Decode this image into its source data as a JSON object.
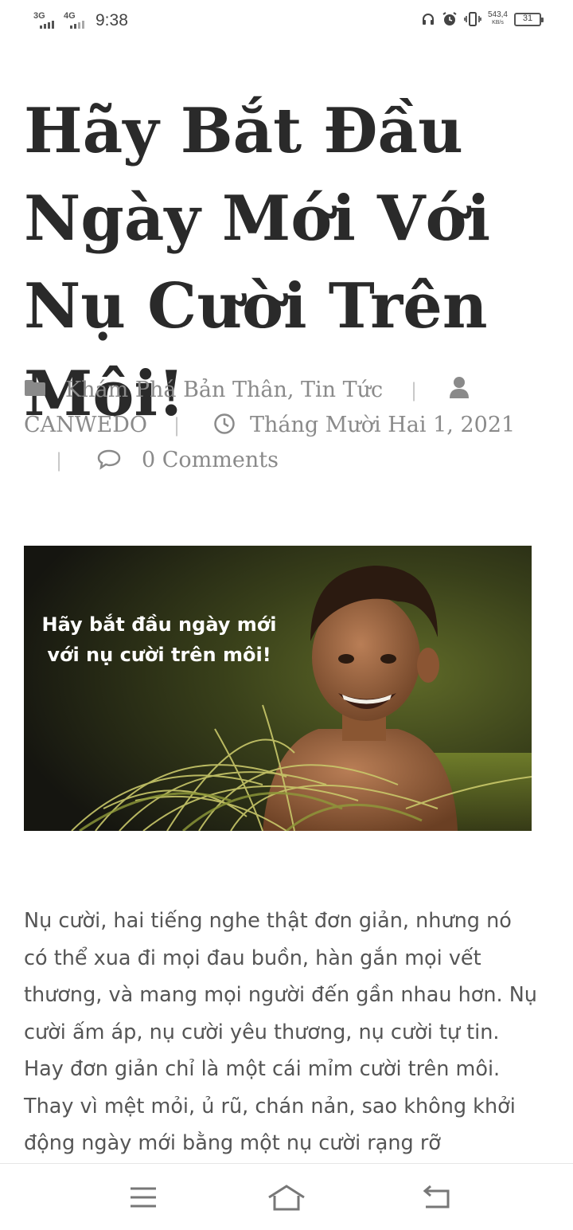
{
  "status_bar": {
    "network_1": "3G",
    "network_2": "4G",
    "time": "9:38",
    "speed_value": "543,4",
    "speed_unit": "KB/s",
    "battery_level": "31"
  },
  "article": {
    "title": "Hãy Bắt Đầu Ngày Mới Với Nụ Cười Trên Môi!",
    "categories": "Khám Phá Bản Thân, Tin Tức",
    "author": "CANWEDO",
    "date": "Tháng Mười Hai 1, 2021",
    "comments": "0 Comments",
    "separator": "|",
    "image_caption_line1": "Hãy bắt đầu ngày mới",
    "image_caption_line2": "với nụ cười trên môi!",
    "body": "Nụ cười, hai tiếng nghe thật đơn giản, nhưng nó có thể xua đi mọi đau buồn, hàn gắn mọi vết thương, và mang mọi người đến gần nhau hơn. Nụ cười ấm áp, nụ cười yêu thương, nụ cười tự tin. Hay đơn giản chỉ là một cái mỉm cười trên môi. Thay vì mệt mỏi, ủ rũ, chán nản, sao không khởi động ngày mới bằng một nụ cười rạng rỡ"
  },
  "nav": {
    "menu_icon": "menu-icon",
    "home_icon": "home-icon",
    "back_icon": "back-icon"
  },
  "colors": {
    "title": "#2a2a2a",
    "meta": "#8a8a8a",
    "body": "#555555"
  }
}
